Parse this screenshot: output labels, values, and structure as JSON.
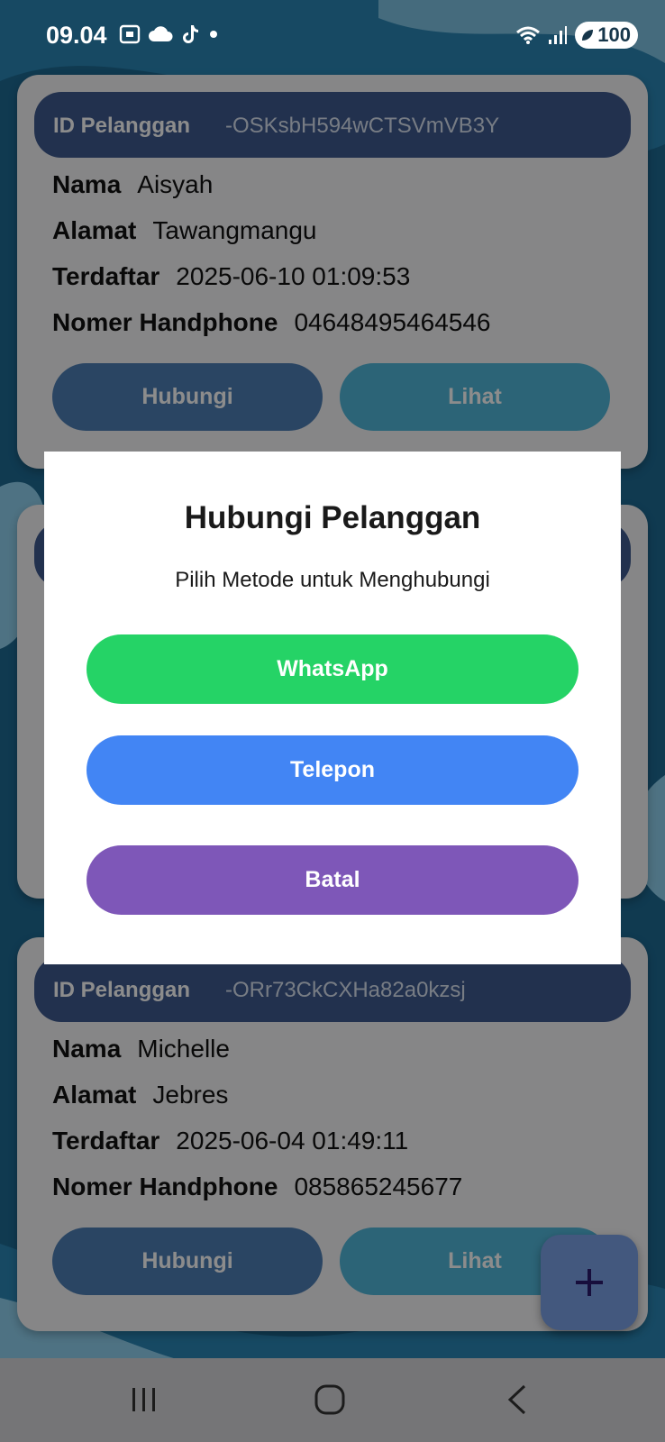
{
  "status_bar": {
    "time": "09.04",
    "battery": "100"
  },
  "customers": [
    {
      "id_label": "ID Pelanggan",
      "id_value": "-OSKsbH594wCTSVmVB3Y",
      "fields": [
        {
          "label": "Nama",
          "value": "Aisyah"
        },
        {
          "label": "Alamat",
          "value": "Tawangmangu"
        },
        {
          "label": "Terdaftar",
          "value": "2025-06-10 01:09:53"
        },
        {
          "label": "Nomer Handphone",
          "value": "04648495464546"
        }
      ],
      "contact_button": "Hubungi",
      "view_button": "Lihat"
    },
    {
      "id_label": "ID Pelanggan",
      "id_value": "-ORr73CkCXHa82a0kzsj",
      "fields": [
        {
          "label": "Nama",
          "value": "Michelle"
        },
        {
          "label": "Alamat",
          "value": "Jebres"
        },
        {
          "label": "Terdaftar",
          "value": "2025-06-04 01:49:11"
        },
        {
          "label": "Nomer Handphone",
          "value": "085865245677"
        }
      ],
      "contact_button": "Hubungi",
      "view_button": "Lihat"
    }
  ],
  "fab": {
    "icon": "plus-icon"
  },
  "dialog": {
    "title": "Hubungi Pelanggan",
    "subtitle": "Pilih Metode untuk Menghubungi",
    "buttons": {
      "whatsapp": "WhatsApp",
      "telepon": "Telepon",
      "batal": "Batal"
    }
  },
  "colors": {
    "header": "#3f5a8e",
    "hubungi": "#4e7fb4",
    "lihat": "#51b6d9",
    "whatsapp": "#25d366",
    "telepon": "#4285f4",
    "batal": "#7e57b8",
    "fab_icon": "#2b1a6e"
  }
}
